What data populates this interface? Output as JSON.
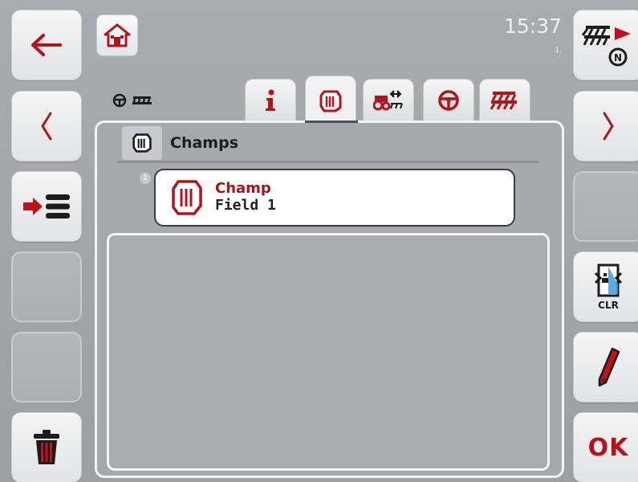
{
  "header": {
    "time": "15:37",
    "time_sub": "1."
  },
  "list": {
    "header_title": "Champs",
    "items": [
      {
        "index": "1",
        "name": "Champ",
        "subtitle": "Field 1"
      }
    ]
  },
  "softkeys": {
    "ok_label": "OK",
    "clr_label": "CLR"
  },
  "tabs": [
    "info-icon",
    "field-icon",
    "implement-geometry-icon",
    "steering-wheel-icon",
    "implement-icon"
  ],
  "colors": {
    "accent": "#b5121b",
    "background": "#a6a8ab",
    "softkey": "#ececec"
  }
}
